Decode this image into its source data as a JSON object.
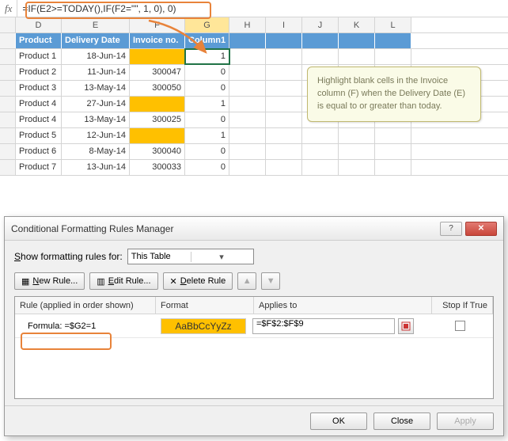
{
  "formula_bar": {
    "fx_label": "fx",
    "formula": "=IF(E2>=TODAY(),IF(F2=\"\", 1, 0), 0)"
  },
  "columns": [
    "D",
    "E",
    "F",
    "G",
    "H",
    "I",
    "J",
    "K",
    "L"
  ],
  "table": {
    "headers": [
      "Product",
      "Delivery Date",
      "Invoice no.",
      "Column1"
    ],
    "rows": [
      {
        "product": "Product 1",
        "date": "18-Jun-14",
        "invoice": "",
        "col1": "1",
        "hi": true
      },
      {
        "product": "Product 2",
        "date": "11-Jun-14",
        "invoice": "300047",
        "col1": "0",
        "hi": false
      },
      {
        "product": "Product 3",
        "date": "13-May-14",
        "invoice": "300050",
        "col1": "0",
        "hi": false
      },
      {
        "product": "Product 4",
        "date": "27-Jun-14",
        "invoice": "",
        "col1": "1",
        "hi": true
      },
      {
        "product": "Product 4",
        "date": "13-May-14",
        "invoice": "300025",
        "col1": "0",
        "hi": false
      },
      {
        "product": "Product 5",
        "date": "12-Jun-14",
        "invoice": "",
        "col1": "1",
        "hi": true
      },
      {
        "product": "Product 6",
        "date": "8-May-14",
        "invoice": "300040",
        "col1": "0",
        "hi": false
      },
      {
        "product": "Product 7",
        "date": "13-Jun-14",
        "invoice": "300033",
        "col1": "0",
        "hi": false
      }
    ]
  },
  "tip": {
    "text": "Highlight blank cells in the Invoice column (F) when the Delivery Date (E) is equal to or greater than today."
  },
  "dialog": {
    "title": "Conditional Formatting Rules Manager",
    "show_label_pre": "S",
    "show_label_post": "how formatting rules for:",
    "scope": "This Table",
    "btn_new_pre": "N",
    "btn_new": "ew Rule...",
    "btn_edit_pre": "E",
    "btn_edit": "dit Rule...",
    "btn_delete_pre": "D",
    "btn_delete": "elete Rule",
    "col_rule": "Rule (applied in order shown)",
    "col_format": "Format",
    "col_applies": "Applies to",
    "col_stop": "Stop If True",
    "rule_text": "Formula: =$G2=1",
    "format_preview": "AaBbCcYyZz",
    "applies_to": "=$F$2:$F$9",
    "btn_ok": "OK",
    "btn_close": "Close",
    "btn_apply": "Apply"
  }
}
